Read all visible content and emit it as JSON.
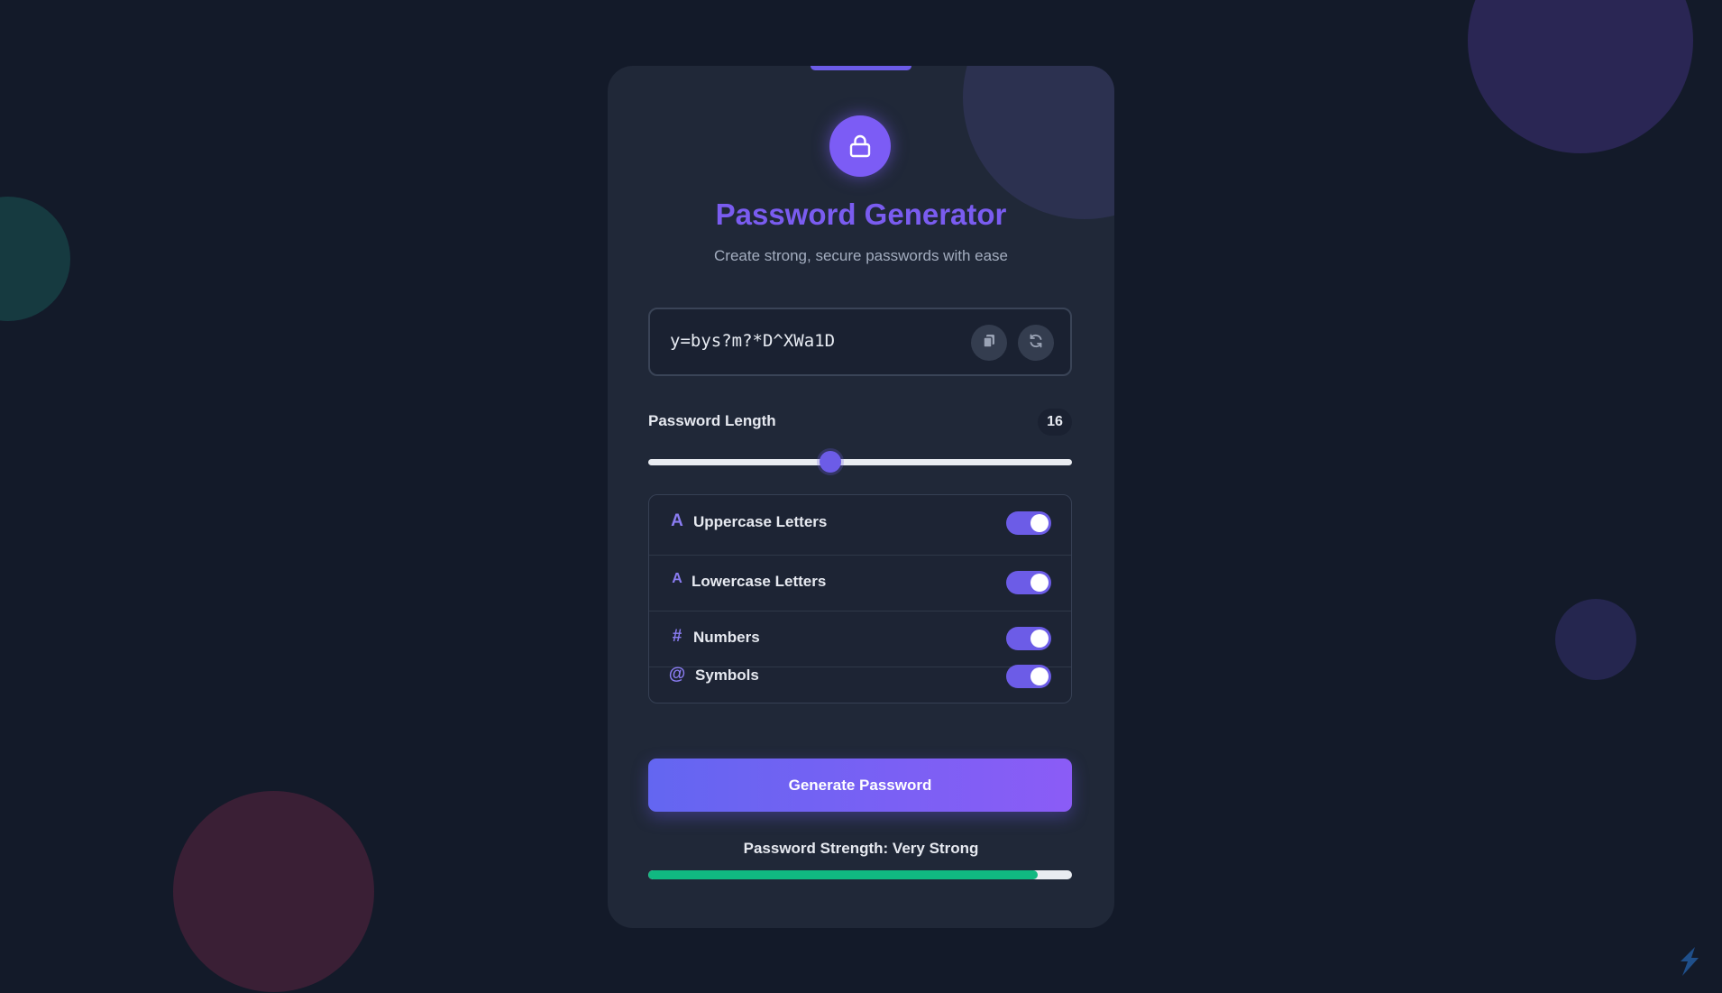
{
  "app": {
    "title": "Password Generator",
    "subtitle": "Create strong, secure passwords with ease"
  },
  "password": {
    "value": "y=bys?m?*D^XWa1D",
    "copy_icon": "copy-icon",
    "refresh_icon": "refresh-icon"
  },
  "length": {
    "label": "Password Length",
    "value": "16",
    "slider_fraction": 0.43
  },
  "options": [
    {
      "icon": "A",
      "icon_name": "uppercase-icon",
      "label": "Uppercase Letters",
      "enabled": true
    },
    {
      "icon": "A",
      "icon_name": "lowercase-icon",
      "label": "Lowercase Letters",
      "enabled": true
    },
    {
      "icon": "#",
      "icon_name": "hash-icon",
      "label": "Numbers",
      "enabled": true
    },
    {
      "icon": "@",
      "icon_name": "at-icon",
      "label": "Symbols",
      "enabled": true
    }
  ],
  "generate_button": {
    "label": "Generate Password"
  },
  "strength": {
    "label": "Password Strength: Very Strong",
    "fraction": 0.92
  },
  "colors": {
    "background": "#131a29",
    "card": "#202838",
    "accent": "#6c5ce7",
    "title": "#7a5cf0",
    "strength_fill": "#10b981"
  }
}
